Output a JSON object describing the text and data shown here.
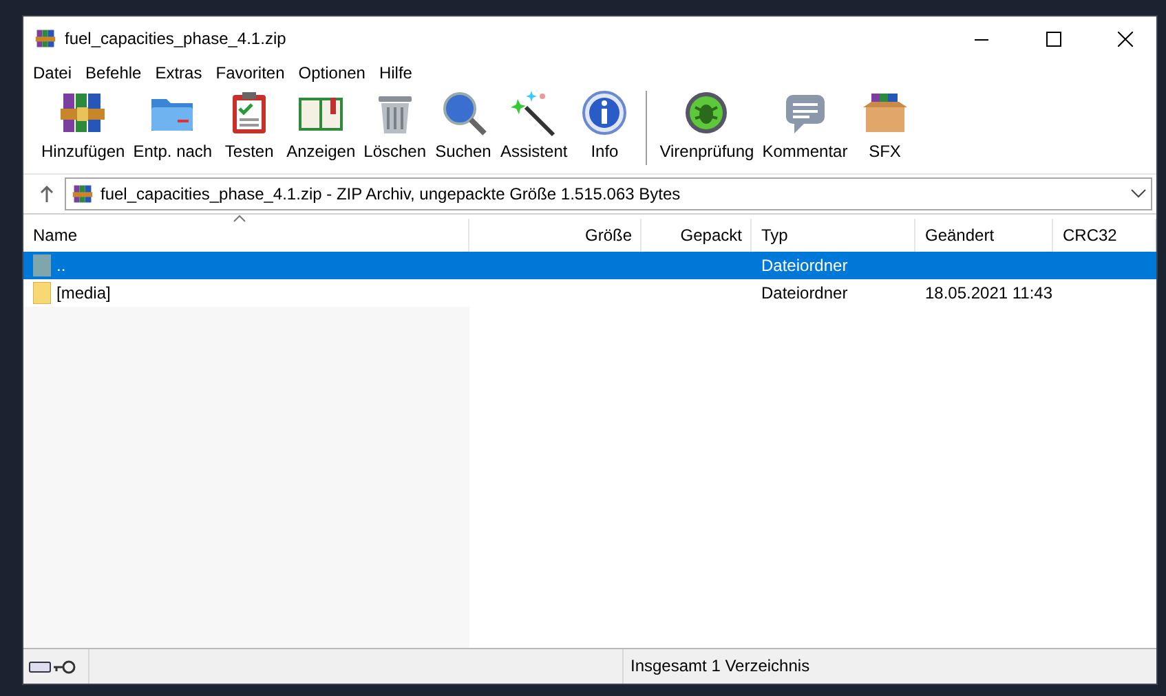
{
  "window": {
    "title": "fuel_capacities_phase_4.1.zip"
  },
  "menu": [
    "Datei",
    "Befehle",
    "Extras",
    "Favoriten",
    "Optionen",
    "Hilfe"
  ],
  "toolbar": {
    "groups": [
      [
        "Hinzufügen",
        "Entp. nach",
        "Testen",
        "Anzeigen",
        "Löschen",
        "Suchen",
        "Assistent",
        "Info"
      ],
      [
        "Virenprüfung",
        "Kommentar",
        "SFX"
      ]
    ]
  },
  "address": {
    "value": "fuel_capacities_phase_4.1.zip - ZIP Archiv, ungepackte Größe 1.515.063 Bytes"
  },
  "table": {
    "columns": [
      {
        "label": "Name",
        "sorted": true
      },
      {
        "label": "Größe",
        "sorted": false
      },
      {
        "label": "Gepackt",
        "sorted": false
      },
      {
        "label": "Typ",
        "sorted": false
      },
      {
        "label": "Geändert",
        "sorted": false
      },
      {
        "label": "CRC32",
        "sorted": false
      }
    ],
    "rows": [
      {
        "kind": "parent",
        "cells": [
          "..",
          "",
          "",
          "Dateiordner",
          "",
          ""
        ],
        "selected": true
      },
      {
        "kind": "folder",
        "cells": [
          "[media]",
          "",
          "",
          "Dateiordner",
          "18.05.2021 11:43",
          ""
        ],
        "selected": false
      }
    ]
  },
  "status_bar": {
    "text": "Insgesamt 1 Verzeichnis"
  }
}
